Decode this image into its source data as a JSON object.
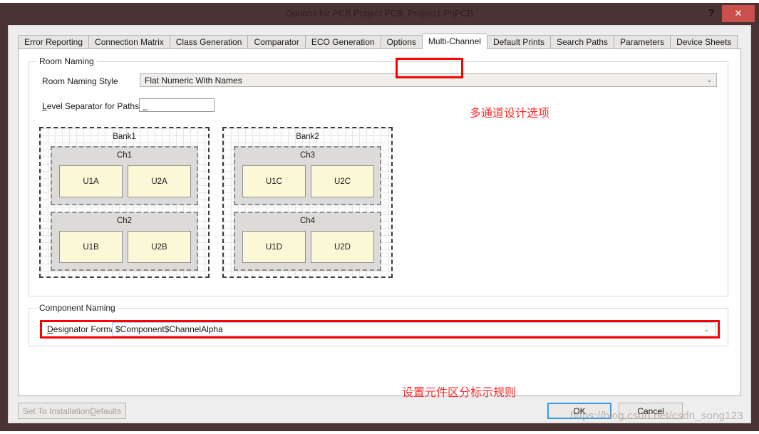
{
  "window": {
    "title": "Options for PCB Project PCB_Project1.PrjPCB",
    "help_button": "?",
    "close_button": "✕",
    "titlebar_color": "#4a3433",
    "close_button_color": "#cb4f4f"
  },
  "tabs": [
    {
      "label": "Error Reporting",
      "active": false
    },
    {
      "label": "Connection Matrix",
      "active": false
    },
    {
      "label": "Class Generation",
      "active": false
    },
    {
      "label": "Comparator",
      "active": false
    },
    {
      "label": "ECO Generation",
      "active": false
    },
    {
      "label": "Options",
      "active": false
    },
    {
      "label": "Multi-Channel",
      "active": true
    },
    {
      "label": "Default Prints",
      "active": false
    },
    {
      "label": "Search Paths",
      "active": false
    },
    {
      "label": "Parameters",
      "active": false
    },
    {
      "label": "Device Sheets",
      "active": false
    }
  ],
  "room_naming": {
    "group_title": "Room Naming",
    "style_label": "Room Naming Style",
    "style_value": "Flat Numeric With Names",
    "separator_label_accel": "L",
    "separator_label_rest": "evel Separator for Paths",
    "separator_value": "_",
    "dropdown_arrow": "⌄"
  },
  "diagram": {
    "banks": [
      {
        "name": "Bank1",
        "channels": [
          {
            "name": "Ch1",
            "components": [
              "U1A",
              "U2A"
            ]
          },
          {
            "name": "Ch2",
            "components": [
              "U1B",
              "U2B"
            ]
          }
        ]
      },
      {
        "name": "Bank2",
        "channels": [
          {
            "name": "Ch3",
            "components": [
              "U1C",
              "U2C"
            ]
          },
          {
            "name": "Ch4",
            "components": [
              "U1D",
              "U2D"
            ]
          }
        ]
      }
    ]
  },
  "component_naming": {
    "group_title": "Component Naming",
    "designator_label_accel": "D",
    "designator_label_rest": "esignator Format",
    "designator_value": "$Component$ChannelAlpha",
    "dropdown_arrow": "⌄"
  },
  "annotations": {
    "top": "多通道设计选项",
    "bottom": "设置元件区分标示规则",
    "color": "#ff2b2b"
  },
  "buttons": {
    "defaults_accel_pre": "Set To Installation ",
    "defaults_accel": "D",
    "defaults_rest": "efaults",
    "ok": "OK",
    "cancel": "Cancel"
  },
  "watermark": "https://blog.csdn.net/csdn_song123"
}
